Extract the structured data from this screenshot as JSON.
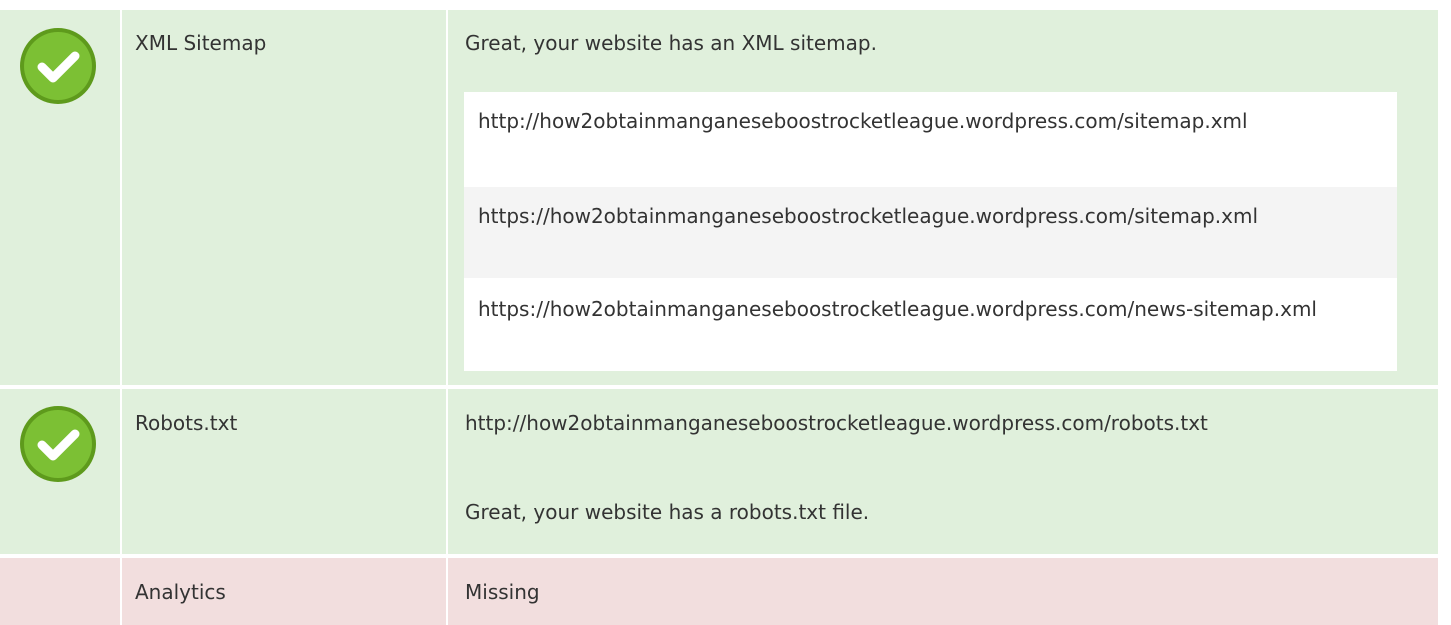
{
  "rows": [
    {
      "label": "XML Sitemap",
      "status": "pass",
      "message": "Great, your website has an XML sitemap.",
      "sitemaps": [
        "http://how2obtainmanganeseboostrocketleague.wordpress.com/sitemap.xml",
        "https://how2obtainmanganeseboostrocketleague.wordpress.com/sitemap.xml",
        "https://how2obtainmanganeseboostrocketleague.wordpress.com/news-sitemap.xml"
      ]
    },
    {
      "label": "Robots.txt",
      "status": "pass",
      "url": "http://how2obtainmanganeseboostrocketleague.wordpress.com/robots.txt",
      "message": "Great, your website has a robots.txt file."
    },
    {
      "label": "Analytics",
      "status": "fail",
      "message": "Missing"
    }
  ],
  "colors": {
    "pass_bg": "#e0f0dc",
    "fail_bg": "#f2dede",
    "check_green": "#7cc034"
  }
}
